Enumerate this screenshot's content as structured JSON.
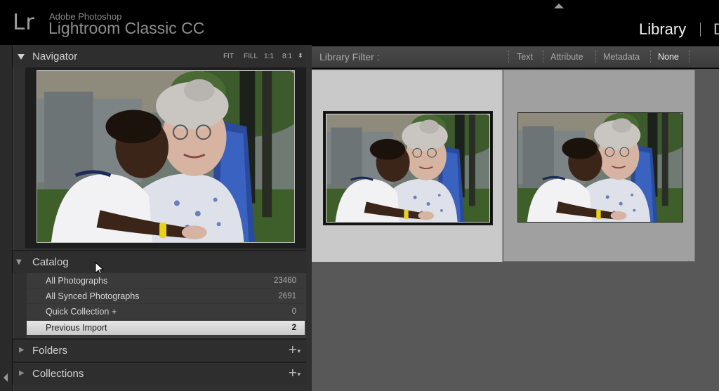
{
  "app": {
    "logo": "Lr",
    "brand_small": "Adobe Photoshop",
    "brand_big": "Lightroom Classic CC"
  },
  "modules": {
    "active": "Library",
    "separator": "|",
    "next_partial": "D"
  },
  "navigator": {
    "title": "Navigator",
    "zoom": [
      "FIT",
      "FILL",
      "1:1",
      "8:1"
    ],
    "zoom_updown": "⬍"
  },
  "catalog": {
    "title": "Catalog",
    "items": [
      {
        "label": "All Photographs",
        "count": "23460"
      },
      {
        "label": "All Synced Photographs",
        "count": "2691"
      },
      {
        "label": "Quick Collection +",
        "count": "0"
      },
      {
        "label": "Previous Import",
        "count": "2",
        "selected": true
      }
    ]
  },
  "folders": {
    "title": "Folders",
    "add": "+"
  },
  "collections": {
    "title": "Collections",
    "add": "+"
  },
  "filter": {
    "title": "Library Filter :",
    "options": [
      "Text",
      "Attribute",
      "Metadata",
      "None"
    ],
    "active": "None"
  },
  "icons": {
    "expanded": "triangle-down-icon",
    "collapsed": "triangle-right-icon",
    "add": "plus-icon",
    "cursor": "mouse-pointer-icon"
  },
  "colors": {
    "panel_bg": "#303030",
    "selected_row": "#d8d8d8",
    "grid_bg": "#585858",
    "selected_cell": "#c9c9c9"
  }
}
